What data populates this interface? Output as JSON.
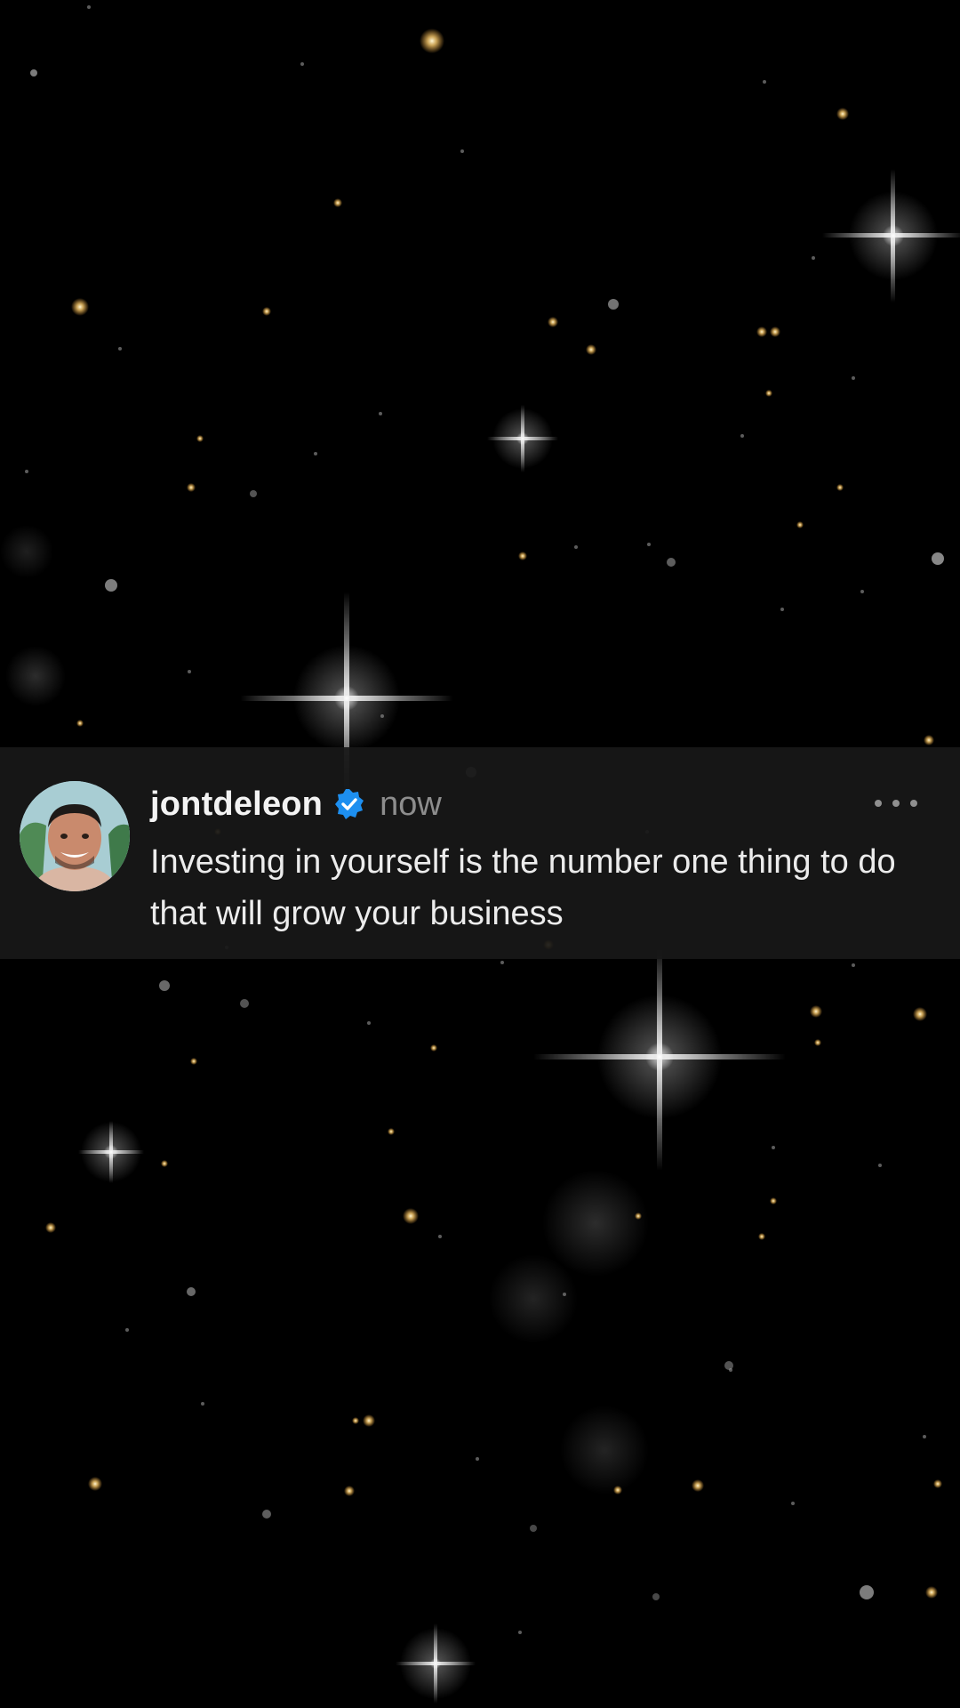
{
  "post": {
    "username": "jontdeleon",
    "verified": true,
    "timestamp": "now",
    "text": "Investing in yourself is the number one thing to do that will grow your business",
    "avatar_icon": "profile-photo",
    "more_icon": "more-horizontal-icon",
    "verified_icon": "verified-badge-icon"
  },
  "colors": {
    "background": "#000000",
    "card": "#181818",
    "verified": "#1d8ff0",
    "star_gold": "#ffd27a",
    "star_white": "#ffffff"
  }
}
